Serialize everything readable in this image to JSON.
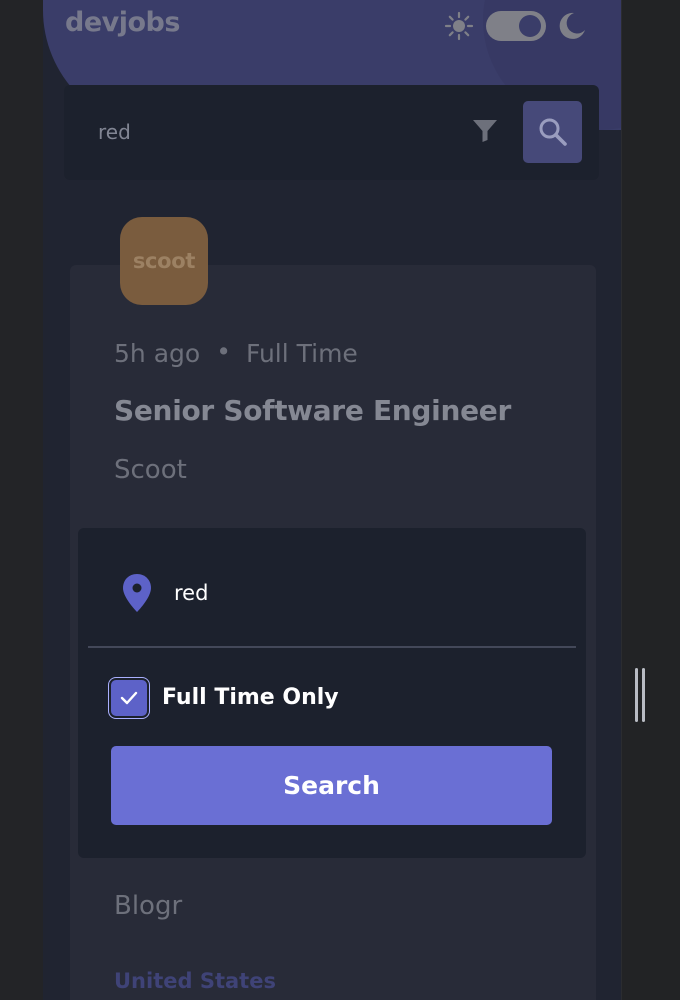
{
  "header": {
    "logo": "devjobs",
    "theme_toggle": {
      "state": "dark",
      "icons": [
        "sun-icon",
        "moon-icon"
      ]
    }
  },
  "search_bar": {
    "query": "red",
    "icons": [
      "filter-icon",
      "search-icon"
    ]
  },
  "job_card_1": {
    "company_logo_text": "scoot",
    "posted": "5h ago",
    "contract": "Full Time",
    "title": "Senior Software Engineer",
    "company": "Scoot"
  },
  "job_card_2": {
    "company": "Blogr",
    "location": "United States"
  },
  "filter_modal": {
    "location": "red",
    "full_time_only_label": "Full Time Only",
    "full_time_only_checked": true,
    "search_label": "Search"
  },
  "colors": {
    "accent": "#6a6fd4",
    "modal_bg": "#1c212d",
    "card_bg": "#282b38"
  }
}
